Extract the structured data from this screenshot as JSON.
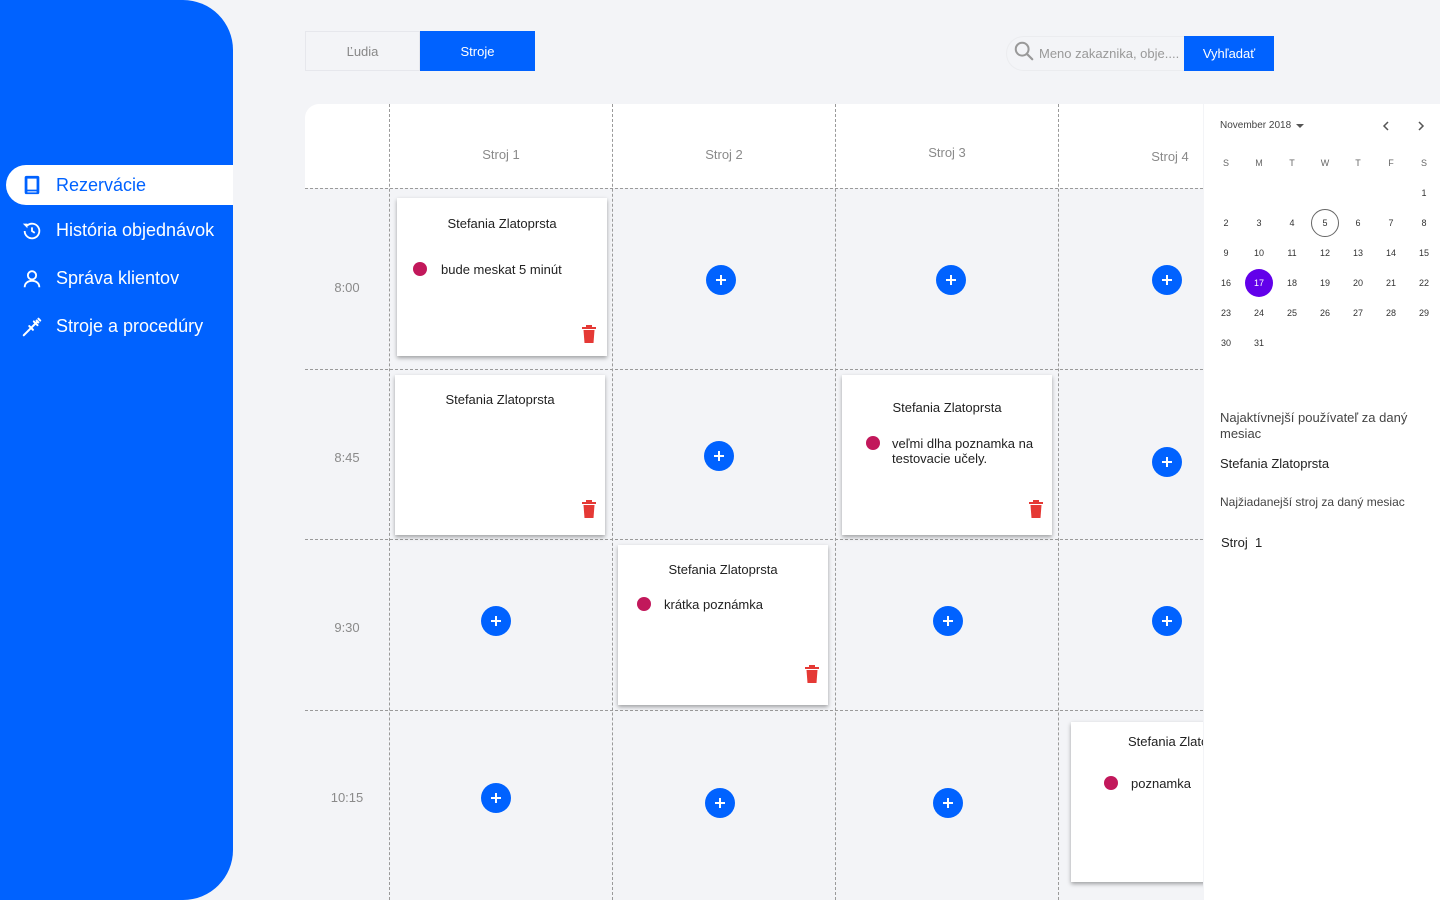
{
  "sidebar": {
    "items": [
      {
        "label": "Rezervácie",
        "icon": "book-icon",
        "active": true
      },
      {
        "label": "História objednávok",
        "icon": "history-icon",
        "active": false
      },
      {
        "label": "Správa klientov",
        "icon": "user-icon",
        "active": false
      },
      {
        "label": "Stroje a procedúry",
        "icon": "syringe-icon",
        "active": false
      }
    ]
  },
  "tabs": [
    {
      "label": "Ľudia",
      "active": false
    },
    {
      "label": "Stroje",
      "active": true
    }
  ],
  "search": {
    "placeholder": "Meno zakaznika, obje....",
    "button_label": "Vyhľadať"
  },
  "schedule": {
    "columns": [
      "Stroj 1",
      "Stroj 2",
      "Stroj 3",
      "Stroj 4"
    ],
    "times": [
      "8:00",
      "8:45",
      "9:30",
      "10:15"
    ],
    "bookings": [
      {
        "customer": "Stefania Zlatoprsta",
        "note": "bude meskat 5 minút"
      },
      {
        "customer": "Stefania Zlatoprsta",
        "note": ""
      },
      {
        "customer": "Stefania Zlatoprsta",
        "note": "veľmi dlha poznamka na testovacie učely."
      },
      {
        "customer": "Stefania Zlatoprsta",
        "note": "krátka poznámka"
      },
      {
        "customer": "Stefania Zlatoprsta",
        "note": "poznamka"
      }
    ]
  },
  "calendar": {
    "month_label": "November 2018",
    "weekdays": [
      "S",
      "M",
      "T",
      "W",
      "T",
      "F",
      "S"
    ],
    "days": [
      "1",
      "2",
      "3",
      "4",
      "5",
      "6",
      "7",
      "8",
      "9",
      "10",
      "11",
      "12",
      "13",
      "14",
      "15",
      "16",
      "17",
      "18",
      "19",
      "20",
      "21",
      "22",
      "23",
      "24",
      "25",
      "26",
      "27",
      "28",
      "29",
      "30",
      "31"
    ],
    "today": "5",
    "selected": "17",
    "selected_color": "#6200ea"
  },
  "stats": {
    "active_user_title": "Najaktívnejší používateľ za daný mesiac",
    "active_user_value": "Stefania Zlatoprsta",
    "top_machine_title": "Najžiadanejší stroj za daný mesiac",
    "top_machine_value": "Stroj  1"
  },
  "colors": {
    "primary": "#0062ff",
    "note_dot": "#c2185b",
    "delete": "#e53935"
  }
}
